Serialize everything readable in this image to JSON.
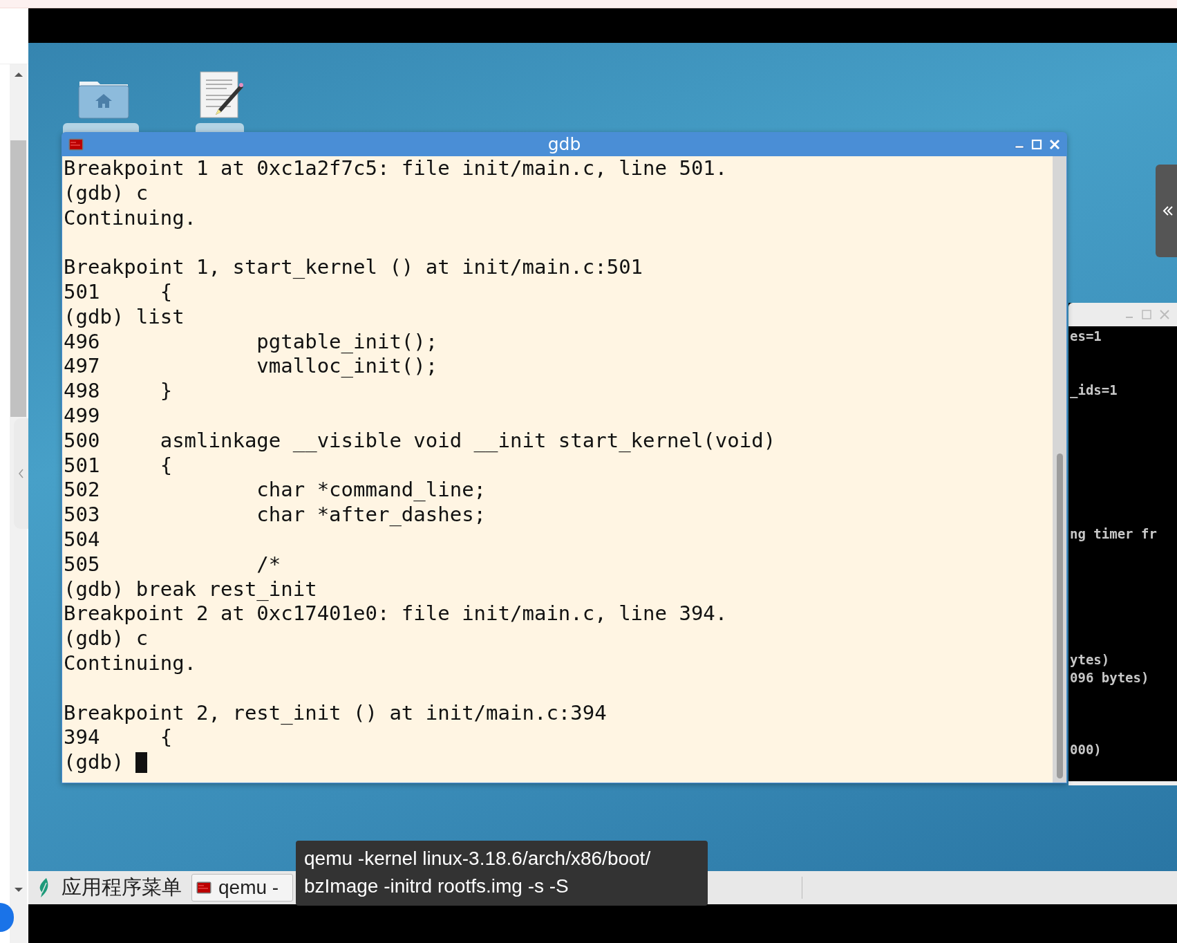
{
  "gdb_window": {
    "title": "gdb",
    "blocks": [
      [
        "Breakpoint 1 at 0xc1a2f7c5: file init/main.c, line 501.",
        "(gdb) c",
        "Continuing."
      ],
      [
        "Breakpoint 1, start_kernel () at init/main.c:501",
        "501     {",
        "(gdb) list",
        "496             pgtable_init();",
        "497             vmalloc_init();",
        "498     }",
        "499",
        "500     asmlinkage __visible void __init start_kernel(void)",
        "501     {",
        "502             char *command_line;",
        "503             char *after_dashes;",
        "504",
        "505             /*",
        "(gdb) break rest_init",
        "Breakpoint 2 at 0xc17401e0: file init/main.c, line 394.",
        "(gdb) c",
        "Continuing."
      ],
      [
        "Breakpoint 2, rest_init () at init/main.c:394",
        "394     {"
      ]
    ],
    "prompt": "(gdb)"
  },
  "background_terminal": {
    "lines": [
      "es=1",
      "_ids=1",
      "ng timer fr",
      "ytes)",
      "096 bytes)",
      "000)"
    ]
  },
  "taskbar": {
    "app_menu": "应用程序菜单",
    "tasks": [
      {
        "label": "qemu -"
      }
    ]
  },
  "tooltip": {
    "lines": [
      "qemu -kernel linux-3.18.6/arch/x86/boot/",
      "bzImage -initrd rootfs.img -s -S"
    ]
  }
}
